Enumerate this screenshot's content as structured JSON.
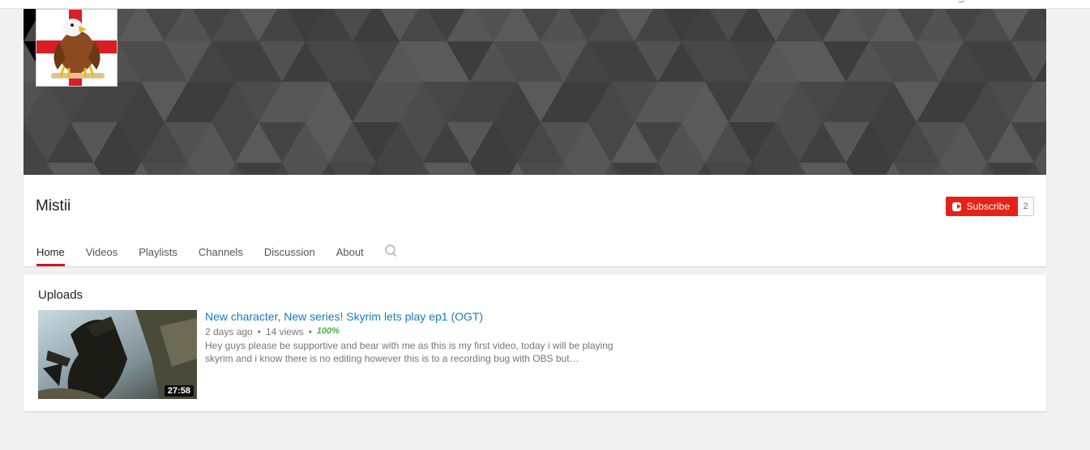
{
  "channel": {
    "name": "Mistii"
  },
  "subscribe": {
    "label": "Subscribe",
    "count": "2"
  },
  "tabs": [
    {
      "label": "Home",
      "active": true
    },
    {
      "label": "Videos"
    },
    {
      "label": "Playlists"
    },
    {
      "label": "Channels"
    },
    {
      "label": "Discussion"
    },
    {
      "label": "About"
    }
  ],
  "uploads": {
    "title": "Uploads",
    "videos": [
      {
        "title": "New character, New series! Skyrim lets play ep1 (OGT)",
        "age": "2 days ago",
        "views": "14 views",
        "rating": "100%",
        "description": "Hey guys please be supportive and bear with me as this is my first video, today i will be playing skyrim and i know there is no editing however this is to a recording bug with OBS but…",
        "duration": "27:58"
      }
    ]
  },
  "colors": {
    "accent": "#e62117",
    "link": "#167ac6",
    "rating": "#4caf50",
    "banner": "#4a4a4a"
  },
  "icons": {
    "search": "search-icon",
    "subscribe": "youtube-play-icon"
  }
}
